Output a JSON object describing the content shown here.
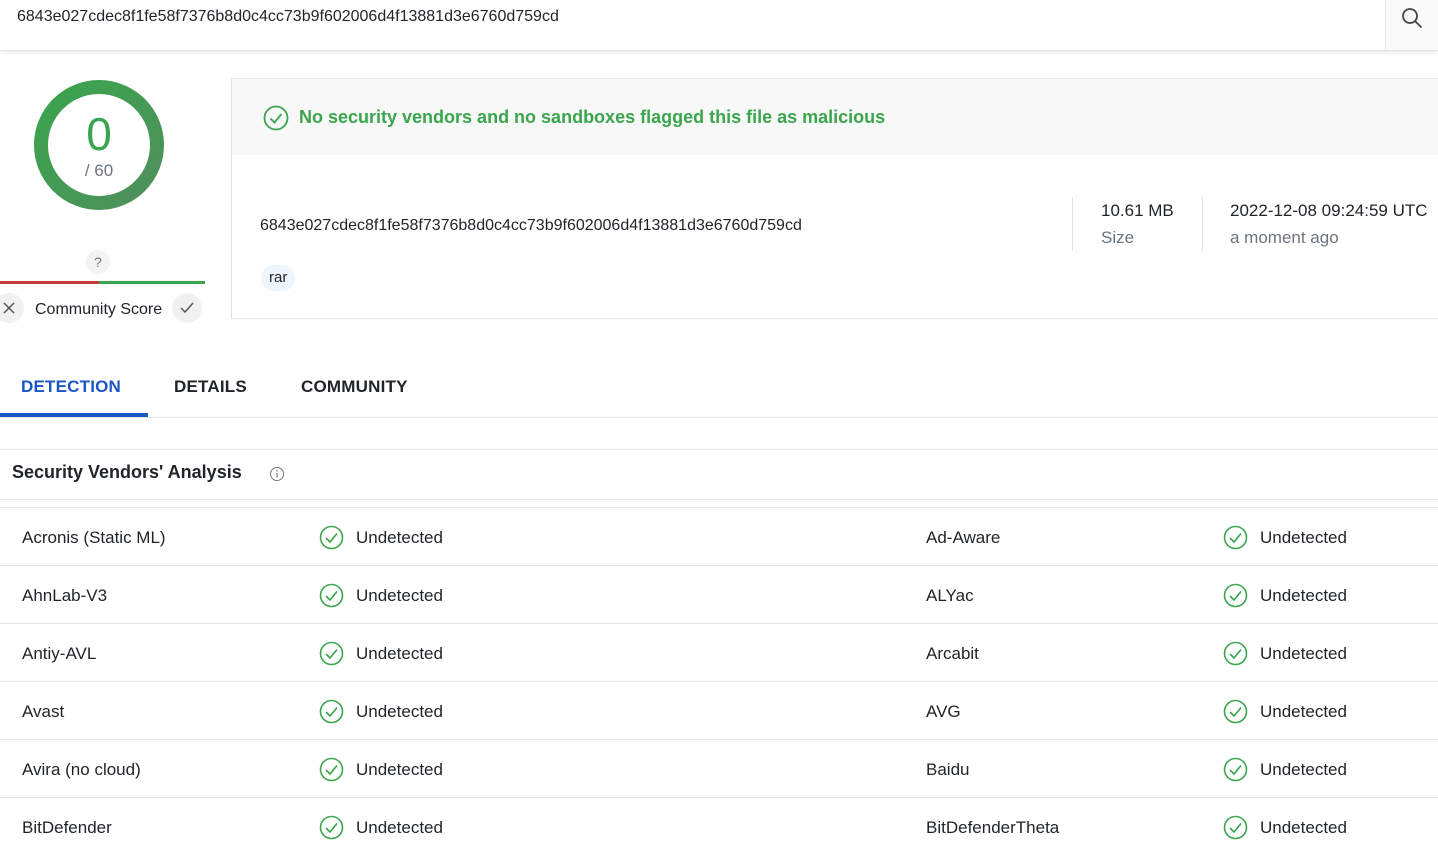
{
  "search": {
    "value": "6843e027cdec8f1fe58f7376b8d0c4cc73b9f602006d4f13881d3e6760d759cd",
    "icon": "search-icon"
  },
  "score": {
    "detections": "0",
    "total": "/ 60",
    "community_unknown": "?",
    "community_label": "Community Score",
    "colors": {
      "clean": "#3aa54d",
      "malicious": "#c23b3b"
    }
  },
  "summary": {
    "verdict": "No security vendors and no sandboxes flagged this file as malicious",
    "hash": "6843e027cdec8f1fe58f7376b8d0c4cc73b9f602006d4f13881d3e6760d759cd",
    "tag": "rar",
    "size_value": "10.61 MB",
    "size_label": "Size",
    "date_value": "2022-12-08 09:24:59 UTC",
    "date_relative": "a moment ago"
  },
  "tabs": [
    {
      "label": "DETECTION",
      "active": true
    },
    {
      "label": "DETAILS",
      "active": false
    },
    {
      "label": "COMMUNITY",
      "active": false
    }
  ],
  "section": {
    "title": "Security Vendors' Analysis",
    "icon": "info-icon"
  },
  "vendors": [
    {
      "left": {
        "name": "Acronis (Static ML)",
        "result": "Undetected"
      },
      "right": {
        "name": "Ad-Aware",
        "result": "Undetected"
      }
    },
    {
      "left": {
        "name": "AhnLab-V3",
        "result": "Undetected"
      },
      "right": {
        "name": "ALYac",
        "result": "Undetected"
      }
    },
    {
      "left": {
        "name": "Antiy-AVL",
        "result": "Undetected"
      },
      "right": {
        "name": "Arcabit",
        "result": "Undetected"
      }
    },
    {
      "left": {
        "name": "Avast",
        "result": "Undetected"
      },
      "right": {
        "name": "AVG",
        "result": "Undetected"
      }
    },
    {
      "left": {
        "name": "Avira (no cloud)",
        "result": "Undetected"
      },
      "right": {
        "name": "Baidu",
        "result": "Undetected"
      }
    },
    {
      "left": {
        "name": "BitDefender",
        "result": "Undetected"
      },
      "right": {
        "name": "BitDefenderTheta",
        "result": "Undetected"
      }
    }
  ]
}
